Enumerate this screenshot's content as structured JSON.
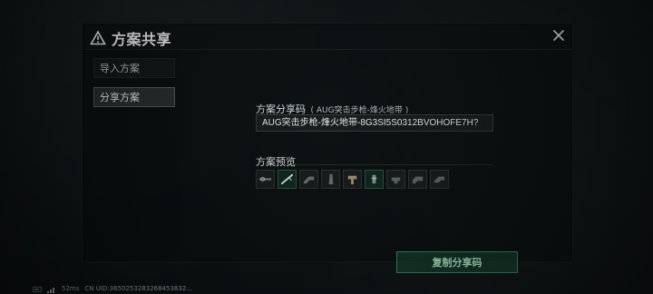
{
  "dialog": {
    "title": "方案共享"
  },
  "sidebar": {
    "items": [
      {
        "label": "导入方案",
        "active": false
      },
      {
        "label": "分享方案",
        "active": true
      }
    ]
  },
  "share": {
    "label": "方案分享码",
    "sublabel": "( AUG突击步枪-烽火地带 )",
    "code": "AUG突击步枪-烽火地带-8G3SI5S0312BVOHOFE7H?"
  },
  "preview": {
    "label": "方案预览",
    "attachments": [
      {
        "icon": "scope-icon",
        "variant": "default"
      },
      {
        "icon": "barrel-icon",
        "variant": "green"
      },
      {
        "icon": "stock-icon",
        "variant": "default"
      },
      {
        "icon": "magazine-icon",
        "variant": "default"
      },
      {
        "icon": "grip-icon",
        "variant": "default"
      },
      {
        "icon": "sight-icon",
        "variant": "green"
      },
      {
        "icon": "handguard-icon",
        "variant": "default"
      },
      {
        "icon": "receiver-icon",
        "variant": "default"
      },
      {
        "icon": "muzzle-icon",
        "variant": "default"
      }
    ]
  },
  "actions": {
    "copy_label": "复制分享码"
  },
  "status": {
    "ping": "52ms",
    "uid": "CN UID:3650253283268453832..."
  }
}
